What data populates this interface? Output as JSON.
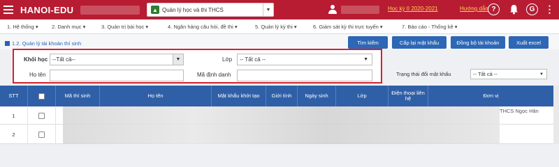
{
  "header": {
    "app_name": "HANOI-EDU",
    "app_select_label": "Quản lý học và thi THCS",
    "term_link": "Học kỳ II 2020-2021",
    "help_link": "Hướng dẫn",
    "help_icon": "?",
    "account_icon": "G"
  },
  "nav": {
    "items": [
      "1. Hệ thống ▾",
      "2. Danh mục ▾",
      "3. Quản trị bài học ▾",
      "4. Ngân hàng câu hỏi, đề thi ▾",
      "5. Quản lý kỳ thi ▾",
      "6. Giám sát kỳ thi trực tuyến ▾",
      "7. Báo cáo - Thống kê ▾"
    ]
  },
  "page": {
    "title": "1.2. Quản lý tài khoản thí sinh",
    "buttons": {
      "search": "Tìm kiếm",
      "reset_password": "Cấp lại mật khẩu",
      "sync_accounts": "Đồng bộ tài khoản",
      "export_excel": "Xuất excel"
    }
  },
  "filters": {
    "grade_label": "Khối học",
    "grade_value": "--Tất cả--",
    "class_label": "Lớp",
    "class_value": "-- Tất cả --",
    "name_label": "Họ tên",
    "name_value": "",
    "id_label": "Mã định danh",
    "id_value": "",
    "password_status_label": "Trạng thái đổi mật khẩu",
    "password_status_value": "-- Tất cả --"
  },
  "table": {
    "headers": {
      "stt": "STT",
      "candidate_id": "Mã thí sinh",
      "full_name": "Họ tên",
      "initial_password": "Mật khẩu khởi tạo",
      "gender": "Giới tính",
      "birth_date": "Ngày sinh",
      "class": "Lớp",
      "phone": "Điện thoại liên hệ",
      "unit": "Đơn vị"
    },
    "rows": [
      {
        "stt": "1",
        "unit": "THCS Ngọc Hân"
      },
      {
        "stt": "2",
        "unit": ""
      }
    ]
  }
}
